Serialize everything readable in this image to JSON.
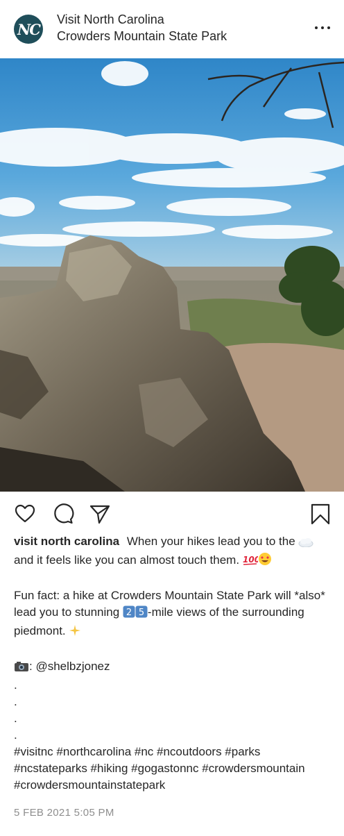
{
  "header": {
    "avatar_text": "NC",
    "account_name": "Visit North Carolina",
    "location": "Crowders Mountain State Park"
  },
  "photo": {
    "description_icon": "rock-outcrop-landscape"
  },
  "actions": {
    "like_icon": "heart-icon",
    "comment_icon": "comment-icon",
    "share_icon": "send-icon",
    "save_icon": "bookmark-icon"
  },
  "caption": {
    "username": "visit north carolina",
    "line1": "When your hikes lead you to the",
    "line1b": "and it feels like you can almost touch them.",
    "line2a": "Fun fact: a hike at Crowders Mountain State Park will *also* lead you to stunning",
    "line2b": "-mile views of the surrounding piedmont.",
    "credit": ": @shelbzjonez",
    "dots": [
      ".",
      ".",
      ".",
      "."
    ],
    "hashtags": "#visitnc #northcarolina #nc #ncoutdoors #parks #ncstateparks #hiking #gogastonnc #crowdersmountain #crowdersmountainstatepark"
  },
  "timestamp": "5 FEB 2021 5:05 PM",
  "colors": {
    "avatar_bg": "#1f4e5a",
    "text": "#262626",
    "muted": "#8e8e8e"
  }
}
